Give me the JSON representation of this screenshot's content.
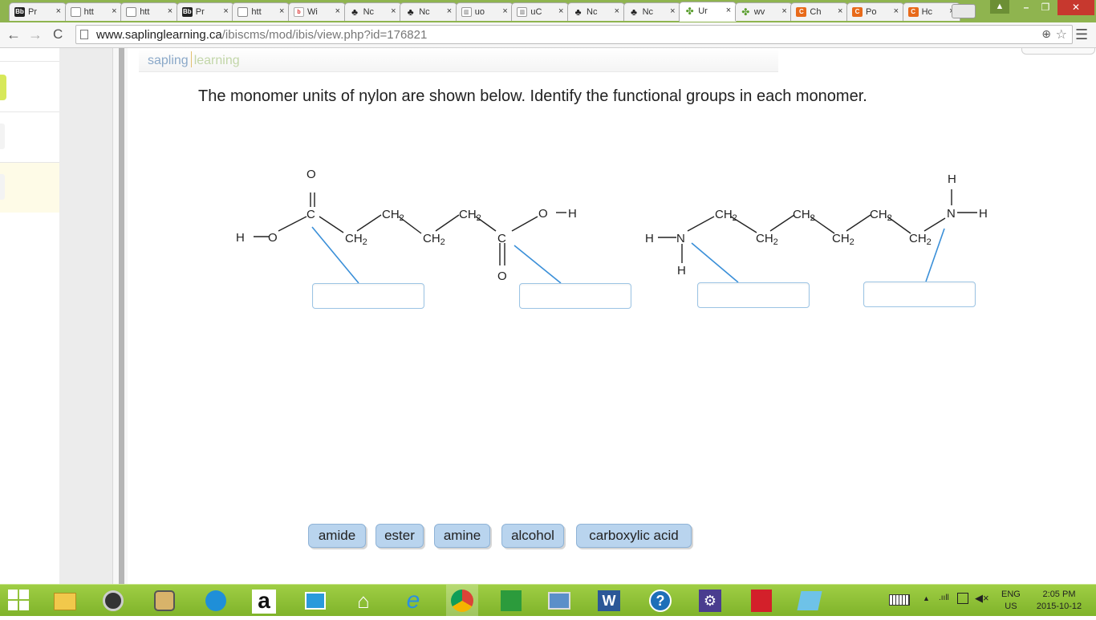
{
  "browser": {
    "tabs": [
      {
        "icon": "bb",
        "glyph": "Bb",
        "label": "Pr"
      },
      {
        "icon": "page",
        "glyph": "",
        "label": "htt"
      },
      {
        "icon": "page",
        "glyph": "",
        "label": "htt"
      },
      {
        "icon": "bb",
        "glyph": "Bb",
        "label": "Pr"
      },
      {
        "icon": "page",
        "glyph": "",
        "label": "htt"
      },
      {
        "icon": "bing",
        "glyph": "b",
        "label": "Wi"
      },
      {
        "icon": "nerd",
        "glyph": "♣",
        "label": "Nc"
      },
      {
        "icon": "nerd",
        "glyph": "♣",
        "label": "Nc"
      },
      {
        "icon": "uo",
        "glyph": "▥",
        "label": "uo"
      },
      {
        "icon": "uo",
        "glyph": "▥",
        "label": "uC"
      },
      {
        "icon": "nerd",
        "glyph": "♣",
        "label": "Nc"
      },
      {
        "icon": "nerd",
        "glyph": "♣",
        "label": "Nc"
      },
      {
        "icon": "leaf",
        "glyph": "✤",
        "label": "Ur",
        "active": true
      },
      {
        "icon": "leaf",
        "glyph": "✤",
        "label": "wv"
      },
      {
        "icon": "chegg",
        "glyph": "C",
        "label": "Ch"
      },
      {
        "icon": "chegg",
        "glyph": "C",
        "label": "Po"
      },
      {
        "icon": "chegg",
        "glyph": "C",
        "label": "Hc"
      }
    ],
    "tab_close": "×",
    "url_domain": "www.saplinglearning.ca",
    "url_path": "/ibiscms/mod/ibis/view.php?id=176821",
    "nav": {
      "back": "←",
      "forward": "→",
      "reload": "C",
      "menu": "☰",
      "zoom": "⊕",
      "star": "☆"
    },
    "window": {
      "minimize": "–",
      "restore": "❐",
      "close": "✕",
      "profile": "▲"
    }
  },
  "page": {
    "logo_left": "sapling",
    "logo_right": "learning",
    "question": "The monomer units of nylon are shown below. Identify the functional groups in each monomer."
  },
  "molecule": {
    "labels": {
      "h": "H",
      "o": "O",
      "c": "C",
      "n": "N",
      "ch2": "CH2"
    }
  },
  "answers": {
    "boxes": [
      "",
      "",
      "",
      ""
    ],
    "bank": [
      "amide",
      "ester",
      "amine",
      "alcohol",
      "carboxylic acid"
    ]
  },
  "taskbar": {
    "icons": [
      "explorer",
      "media",
      "photos",
      "sync",
      "amazon",
      "store",
      "home",
      "ie",
      "chrome",
      "office",
      "remote",
      "word",
      "help",
      "settings",
      "acrobat",
      "notes"
    ],
    "amazon_glyph": "a",
    "ie_glyph": "e",
    "help_glyph": "?",
    "word_glyph": "W",
    "settings_glyph": "⚙",
    "tray_up": "▲",
    "signal": ".ııll",
    "volume": "◀×",
    "lang_top": "ENG",
    "lang_bottom": "US",
    "time": "2:05 PM",
    "date": "2015-10-12"
  },
  "colors": {
    "taskbar": "#8fc03a",
    "tab_strip": "#8fb44f",
    "leader_line": "#3a8fd8",
    "chip_fill": "#b9d4ee",
    "close_button": "#c7382e"
  }
}
